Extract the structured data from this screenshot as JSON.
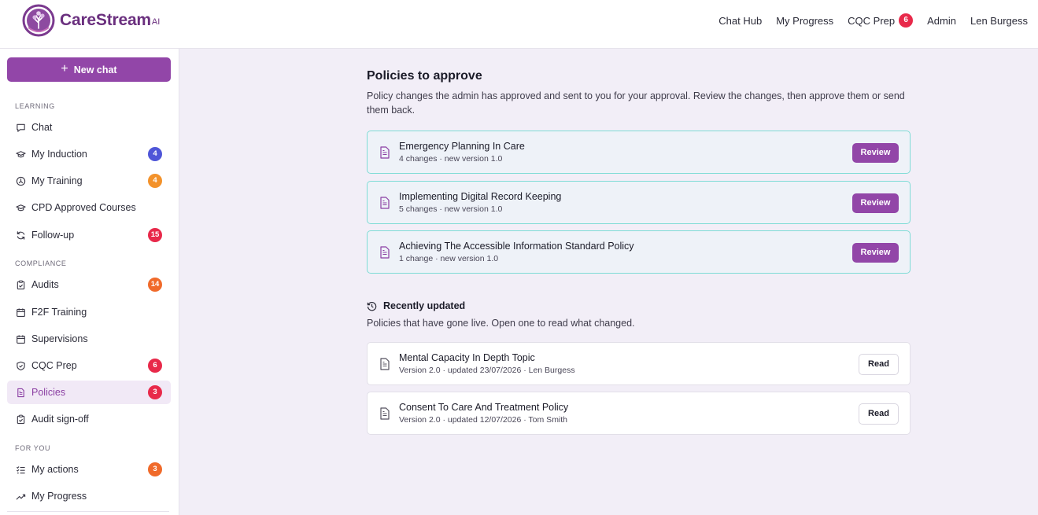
{
  "brand": {
    "name": "CareStream",
    "suffix": "AI"
  },
  "topnav": {
    "items": [
      {
        "label": "Chat Hub"
      },
      {
        "label": "My Progress"
      },
      {
        "label": "CQC Prep",
        "badge": "6"
      },
      {
        "label": "Admin"
      },
      {
        "label": "Len Burgess"
      }
    ]
  },
  "sidebar": {
    "new_chat": "New chat",
    "sections": {
      "learning": "LEARNING",
      "compliance": "COMPLIANCE",
      "for_you": "FOR YOU"
    },
    "items": [
      {
        "label": "Chat",
        "icon": "chat-icon"
      },
      {
        "label": "My Induction",
        "icon": "graduation-cap-icon",
        "badge": "4",
        "badge_color": "#4f56d8"
      },
      {
        "label": "My Training",
        "icon": "training-icon",
        "badge": "4",
        "badge_color": "#f3922b"
      },
      {
        "label": "CPD Approved Courses",
        "icon": "graduation-cap-icon"
      },
      {
        "label": "Follow-up",
        "icon": "refresh-icon",
        "badge": "15",
        "badge_color": "#e8294a"
      },
      {
        "label": "Audits",
        "icon": "clipboard-check-icon",
        "badge": "14",
        "badge_color": "#f06a2a"
      },
      {
        "label": "F2F Training",
        "icon": "calendar-icon"
      },
      {
        "label": "Supervisions",
        "icon": "calendar-icon"
      },
      {
        "label": "CQC Prep",
        "icon": "shield-check-icon",
        "badge": "6",
        "badge_color": "#e8294a"
      },
      {
        "label": "Policies",
        "icon": "document-icon",
        "badge": "3",
        "badge_color": "#e8294a",
        "active": true
      },
      {
        "label": "Audit sign-off",
        "icon": "clipboard-check-icon"
      },
      {
        "label": "My actions",
        "icon": "checklist-icon",
        "badge": "3",
        "badge_color": "#f06a2a"
      },
      {
        "label": "My Progress",
        "icon": "trending-up-icon"
      }
    ]
  },
  "main": {
    "title": "Policies to approve",
    "subtitle": "Policy changes the admin has approved and sent to you for your approval. Review the changes, then approve them or send them back.",
    "pending": [
      {
        "title": "Emergency Planning In Care",
        "meta": "4 changes · new version 1.0",
        "action": "Review"
      },
      {
        "title": "Implementing Digital Record Keeping",
        "meta": "5 changes · new version 1.0",
        "action": "Review"
      },
      {
        "title": "Achieving The Accessible Information Standard Policy",
        "meta": "1 change · new version 1.0",
        "action": "Review"
      }
    ],
    "recent_title": "Recently updated",
    "recent_subtitle": "Policies that have gone live. Open one to read what changed.",
    "recent": [
      {
        "title": "Mental Capacity In Depth Topic",
        "meta": "Version 2.0 · updated 23/07/2026 · Len Burgess",
        "action": "Read"
      },
      {
        "title": "Consent To Care And Treatment Policy",
        "meta": "Version 2.0 · updated 12/07/2026 · Tom Smith",
        "action": "Read"
      }
    ]
  },
  "colors": {
    "accent": "#9246a8",
    "pending_border": "#7fdcd6",
    "badge_red": "#e8294a"
  }
}
